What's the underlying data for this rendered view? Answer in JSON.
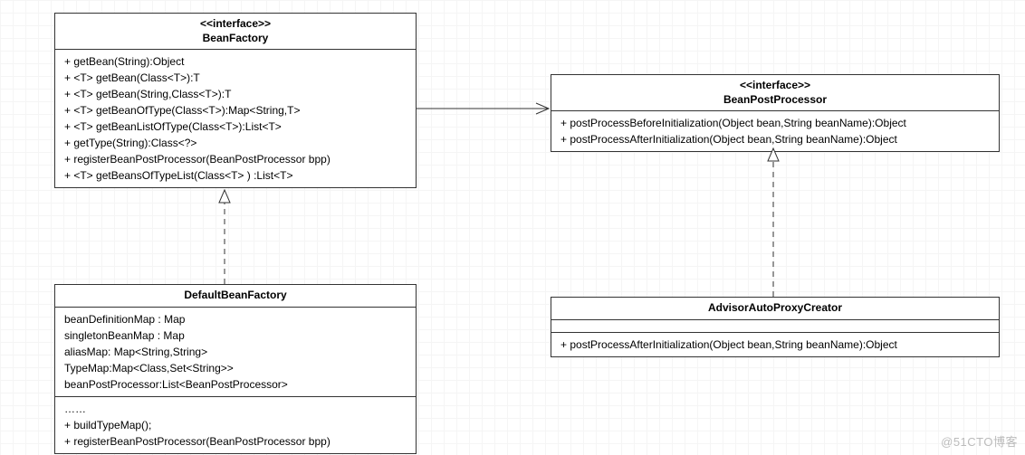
{
  "watermark": "@51CTO博客",
  "beanFactory": {
    "stereotype": "<<interface>>",
    "name": "BeanFactory",
    "methods": [
      "+ getBean(String):Object",
      "+ <T> getBean(Class<T>):T",
      "+ <T> getBean(String,Class<T>):T",
      "+ <T> getBeanOfType(Class<T>):Map<String,T>",
      "+ <T> getBeanListOfType(Class<T>):List<T>",
      "+ getType(String):Class<?>",
      "+ registerBeanPostProcessor(BeanPostProcessor bpp)",
      "+ <T> getBeansOfTypeList(Class<T> ) :List<T>"
    ]
  },
  "beanPostProcessor": {
    "stereotype": "<<interface>>",
    "name": "BeanPostProcessor",
    "methods": [
      "+ postProcessBeforeInitialization(Object bean,String beanName):Object",
      "+ postProcessAfterInitialization(Object bean,String beanName):Object"
    ]
  },
  "defaultBeanFactory": {
    "name": "DefaultBeanFactory",
    "attributes": [
      "beanDefinitionMap : Map",
      "singletonBeanMap : Map",
      "aliasMap: Map<String,String>",
      "TypeMap:Map<Class,Set<String>>",
      "beanPostProcessor:List<BeanPostProcessor>"
    ],
    "methods": [
      "……",
      "+ buildTypeMap();",
      "+ registerBeanPostProcessor(BeanPostProcessor bpp)"
    ]
  },
  "advisorAutoProxyCreator": {
    "name": "AdvisorAutoProxyCreator",
    "methods": [
      "+ postProcessAfterInitialization(Object bean,String beanName):Object"
    ]
  },
  "chart_data": {
    "type": "uml_class_diagram",
    "classes": [
      {
        "id": "BeanFactory",
        "stereotype": "interface"
      },
      {
        "id": "BeanPostProcessor",
        "stereotype": "interface"
      },
      {
        "id": "DefaultBeanFactory",
        "stereotype": "class"
      },
      {
        "id": "AdvisorAutoProxyCreator",
        "stereotype": "class"
      }
    ],
    "relationships": [
      {
        "from": "BeanFactory",
        "to": "BeanPostProcessor",
        "type": "dependency",
        "style": "solid-open-arrow"
      },
      {
        "from": "DefaultBeanFactory",
        "to": "BeanFactory",
        "type": "realization",
        "style": "dashed-triangle-arrow"
      },
      {
        "from": "AdvisorAutoProxyCreator",
        "to": "BeanPostProcessor",
        "type": "realization",
        "style": "dashed-triangle-arrow"
      }
    ]
  }
}
